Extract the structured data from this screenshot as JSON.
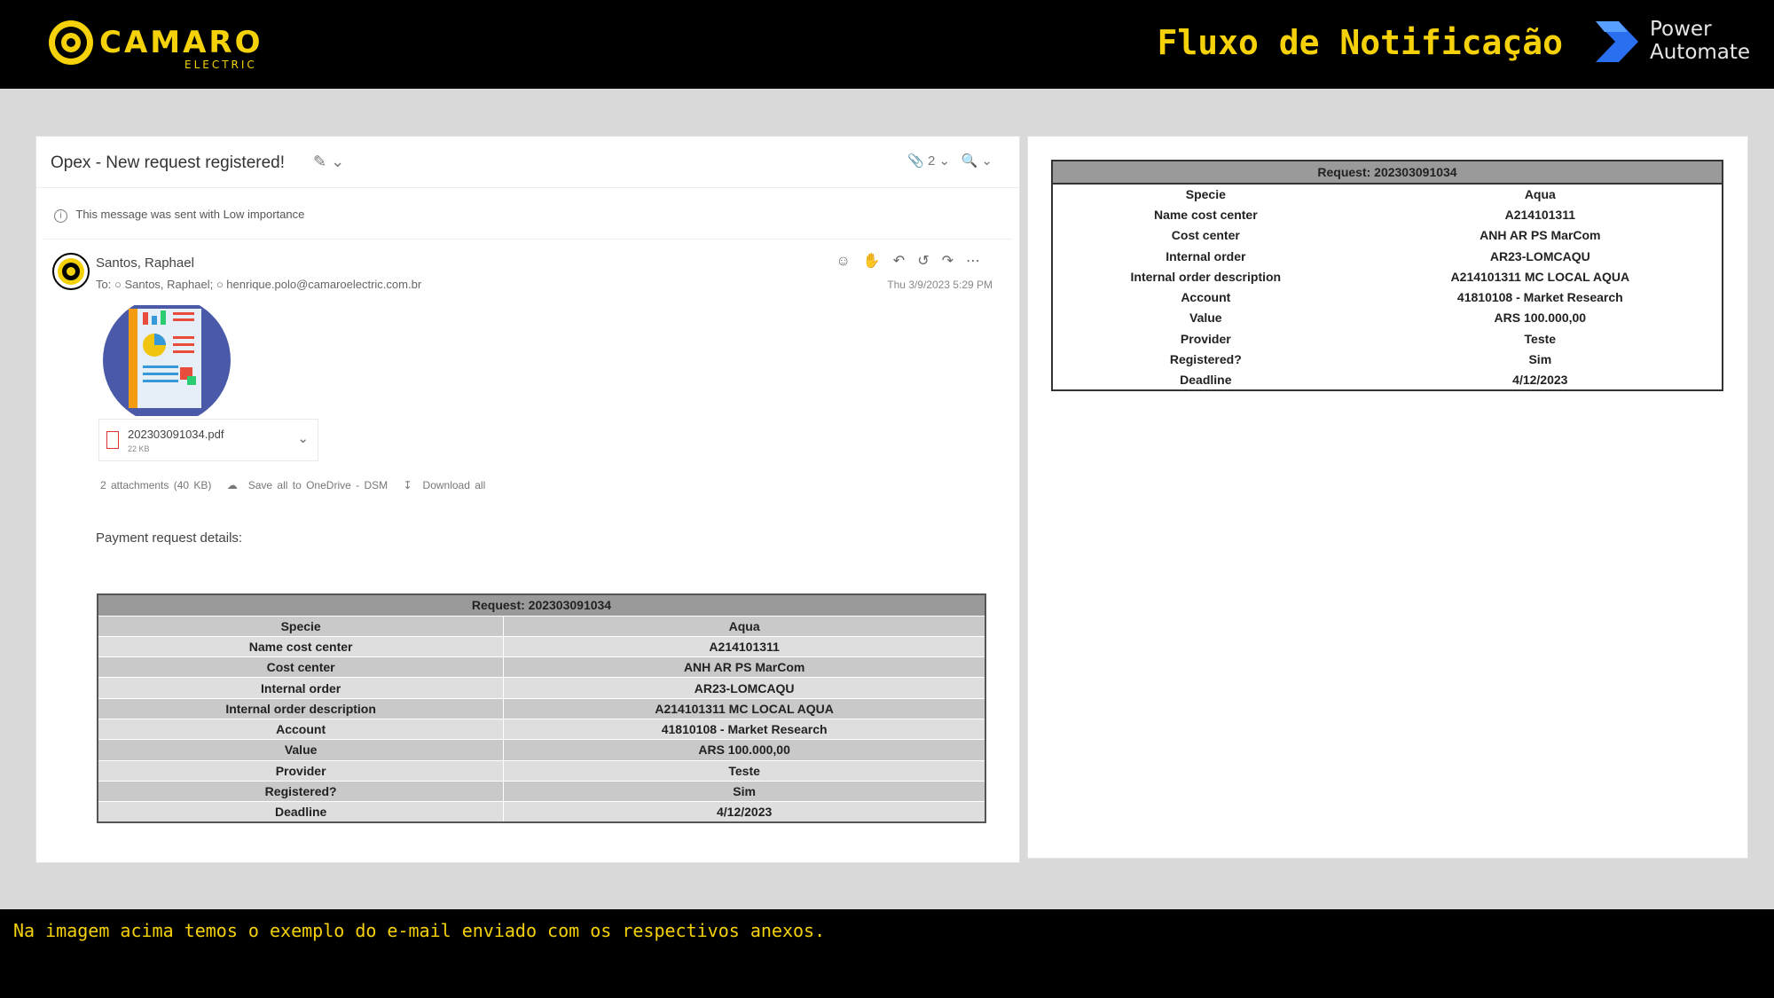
{
  "header": {
    "logo_text": "CAMARO",
    "logo_sub": "ELECTRIC",
    "title": "Fluxo de Notificação",
    "pa_line1": "Power",
    "pa_line2": "Automate"
  },
  "email": {
    "subject": "Opex - New request registered!",
    "attach_count": "2",
    "importance": "This message was sent with Low importance",
    "sender": "Santos, Raphael",
    "to_label": "To:",
    "to_recipient1": "Santos, Raphael;",
    "to_recipient2": "henrique.polo@camaroelectric.com.br",
    "date": "Thu 3/9/2023 5:29 PM",
    "attachment_name": "202303091034.pdf",
    "attachment_size": "22 KB",
    "attachments_summary": "2 attachments (40 KB)",
    "save_all": "Save all to OneDrive - DSM",
    "download_all": "Download all",
    "payment_details": "Payment request details:"
  },
  "request": {
    "title": "Request: 202303091034",
    "rows": [
      {
        "label": "Specie",
        "value": "Aqua"
      },
      {
        "label": "Name cost center",
        "value": "A214101311"
      },
      {
        "label": "Cost center",
        "value": "ANH AR PS MarCom"
      },
      {
        "label": "Internal order",
        "value": "AR23-LOMCAQU"
      },
      {
        "label": "Internal order description",
        "value": "A214101311 MC LOCAL AQUA"
      },
      {
        "label": "Account",
        "value": "41810108 - Market Research"
      },
      {
        "label": "Value",
        "value": "ARS 100.000,00"
      },
      {
        "label": "Provider",
        "value": "Teste"
      },
      {
        "label": "Registered?",
        "value": "Sim"
      },
      {
        "label": "Deadline",
        "value": "4/12/2023"
      }
    ]
  },
  "footer": {
    "caption": "Na imagem acima temos o exemplo do e-mail enviado com os respectivos anexos."
  },
  "colors": {
    "accent": "#f5d10a",
    "header_bg": "#000000",
    "table_header": "#9a9a9a"
  }
}
